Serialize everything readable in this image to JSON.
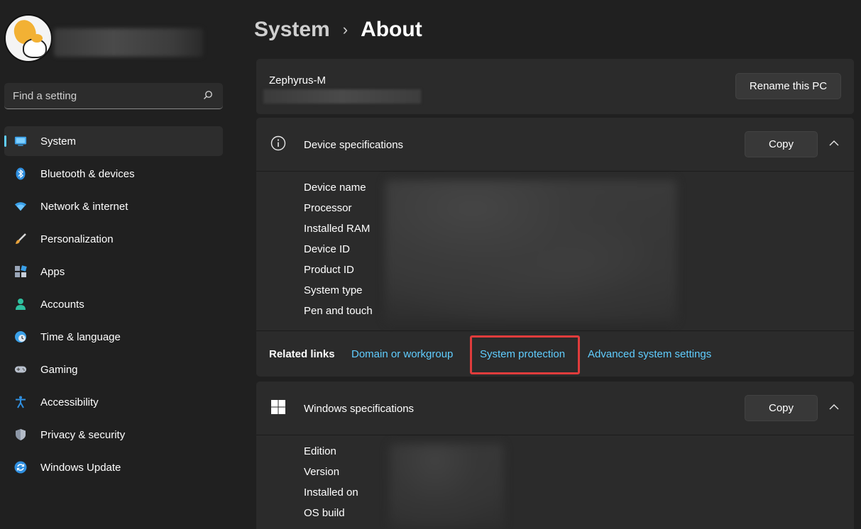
{
  "sidebar": {
    "search_placeholder": "Find a setting",
    "items": [
      {
        "label": "System",
        "icon": "display-icon",
        "active": true
      },
      {
        "label": "Bluetooth & devices",
        "icon": "bluetooth-icon"
      },
      {
        "label": "Network & internet",
        "icon": "wifi-icon"
      },
      {
        "label": "Personalization",
        "icon": "paintbrush-icon"
      },
      {
        "label": "Apps",
        "icon": "apps-icon"
      },
      {
        "label": "Accounts",
        "icon": "person-icon"
      },
      {
        "label": "Time & language",
        "icon": "globe-clock-icon"
      },
      {
        "label": "Gaming",
        "icon": "gamepad-icon"
      },
      {
        "label": "Accessibility",
        "icon": "accessibility-icon"
      },
      {
        "label": "Privacy & security",
        "icon": "shield-icon"
      },
      {
        "label": "Windows Update",
        "icon": "update-icon"
      }
    ]
  },
  "breadcrumb": {
    "parent": "System",
    "separator": "›",
    "current": "About"
  },
  "pc_card": {
    "name": "Zephyrus-M",
    "rename_label": "Rename this PC"
  },
  "device_specs": {
    "title": "Device specifications",
    "copy_label": "Copy",
    "rows": [
      "Device name",
      "Processor",
      "Installed RAM",
      "Device ID",
      "Product ID",
      "System type",
      "Pen and touch"
    ]
  },
  "related_links": {
    "label": "Related links",
    "links": [
      "Domain or workgroup",
      "System protection",
      "Advanced system settings"
    ]
  },
  "windows_specs": {
    "title": "Windows specifications",
    "copy_label": "Copy",
    "rows": [
      "Edition",
      "Version",
      "Installed on",
      "OS build"
    ]
  },
  "colors": {
    "accent": "#60cdff",
    "highlight_border": "#e03c3c",
    "background": "#202020",
    "card": "#2b2b2b"
  }
}
